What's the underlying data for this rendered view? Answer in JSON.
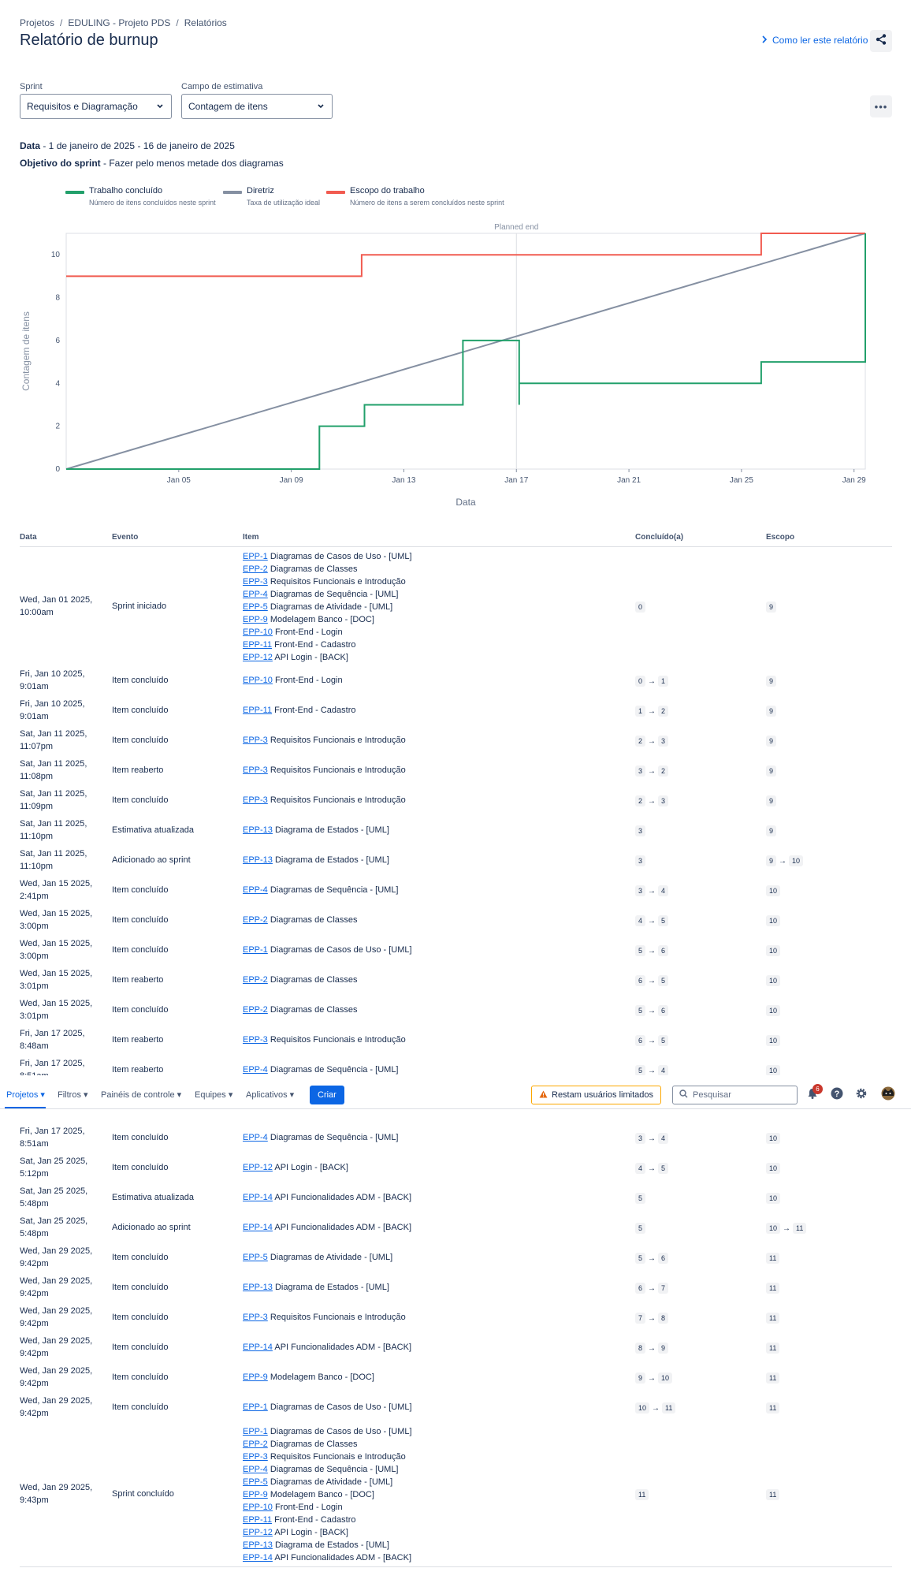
{
  "breadcrumb": {
    "projects": "Projetos",
    "project": "EDULING - Projeto PDS",
    "reports": "Relatórios"
  },
  "page_title": "Relatório de burnup",
  "how_to_read": "Como ler este relatório",
  "filters": {
    "sprint_label": "Sprint",
    "sprint_value": "Requisitos e Diagramação",
    "estimate_label": "Campo de estimativa",
    "estimate_value": "Contagem de itens"
  },
  "info": {
    "date_label": "Data",
    "date_value": " - 1 de janeiro de 2025 - 16 de janeiro de 2025",
    "goal_label": "Objetivo do sprint",
    "goal_value": " - Fazer pelo menos metade dos diagramas"
  },
  "legend": [
    {
      "name": "Trabalho concluído",
      "desc": "Número de itens concluídos neste sprint",
      "color": "#22a06b"
    },
    {
      "name": "Diretriz",
      "desc": "Taxa de utilização ideal",
      "color": "#8590a2"
    },
    {
      "name": "Escopo do trabalho",
      "desc": "Número de itens a serem concluídos neste sprint",
      "color": "#f15b50"
    }
  ],
  "chart_data": {
    "type": "line",
    "annotation": "Planned end",
    "annotation_x": 17.0,
    "xlabel": "Data",
    "ylabel": "Contagem de itens",
    "xlim": [
      1.0,
      29.4
    ],
    "ylim": [
      0,
      11
    ],
    "x_ticks": [
      {
        "x": 5,
        "label": "Jan 05"
      },
      {
        "x": 9,
        "label": "Jan 09"
      },
      {
        "x": 13,
        "label": "Jan 13"
      },
      {
        "x": 17,
        "label": "Jan 17"
      },
      {
        "x": 21,
        "label": "Jan 21"
      },
      {
        "x": 25,
        "label": "Jan 25"
      },
      {
        "x": 29,
        "label": "Jan 29"
      }
    ],
    "y_ticks": [
      0,
      2,
      4,
      6,
      8,
      10
    ],
    "series": [
      {
        "name": "Trabalho concluído",
        "color": "#22a06b",
        "points": [
          [
            1.0,
            0
          ],
          [
            10.0,
            0
          ],
          [
            10.0,
            2
          ],
          [
            11.6,
            2
          ],
          [
            11.6,
            3
          ],
          [
            15.1,
            3
          ],
          [
            15.1,
            6
          ],
          [
            17.1,
            6
          ],
          [
            17.1,
            4
          ],
          [
            17.1,
            3
          ],
          [
            17.1,
            4
          ],
          [
            25.7,
            4
          ],
          [
            25.7,
            5
          ],
          [
            29.4,
            5
          ],
          [
            29.4,
            11
          ]
        ]
      },
      {
        "name": "Diretriz",
        "color": "#8590a2",
        "points": [
          [
            1.0,
            0
          ],
          [
            29.4,
            11
          ]
        ]
      },
      {
        "name": "Escopo do trabalho",
        "color": "#f15b50",
        "points": [
          [
            1.0,
            9
          ],
          [
            11.5,
            9
          ],
          [
            11.5,
            10
          ],
          [
            25.7,
            10
          ],
          [
            25.7,
            11
          ],
          [
            29.4,
            11
          ]
        ]
      }
    ]
  },
  "table": {
    "headers": [
      "Data",
      "Evento",
      "Item",
      "Concluído(a)",
      "Escopo"
    ],
    "rows": [
      {
        "date": [
          "Wed, Jan 01 2025,",
          "10:00am"
        ],
        "event": "Sprint iniciado",
        "items": [
          [
            "EPP-1",
            "Diagramas de Casos de Uso - [UML]"
          ],
          [
            "EPP-2",
            "Diagramas de Classes"
          ],
          [
            "EPP-3",
            "Requisitos Funcionais e Introdução"
          ],
          [
            "EPP-4",
            "Diagramas de Sequência - [UML]"
          ],
          [
            "EPP-5",
            "Diagramas de Atividade - [UML]"
          ],
          [
            "EPP-9",
            "Modelagem Banco - [DOC]"
          ],
          [
            "EPP-10",
            "Front-End - Login"
          ],
          [
            "EPP-11",
            "Front-End - Cadastro"
          ],
          [
            "EPP-12",
            "API Login - [BACK]"
          ]
        ],
        "done": [
          "0"
        ],
        "scope": [
          "9"
        ]
      },
      {
        "date": [
          "Fri, Jan 10 2025,",
          "9:01am"
        ],
        "event": "Item concluído",
        "items": [
          [
            "EPP-10",
            "Front-End - Login"
          ]
        ],
        "done": [
          "0",
          "1"
        ],
        "scope": [
          "9"
        ]
      },
      {
        "date": [
          "Fri, Jan 10 2025,",
          "9:01am"
        ],
        "event": "Item concluído",
        "items": [
          [
            "EPP-11",
            "Front-End - Cadastro"
          ]
        ],
        "done": [
          "1",
          "2"
        ],
        "scope": [
          "9"
        ]
      },
      {
        "date": [
          "Sat, Jan 11 2025,",
          "11:07pm"
        ],
        "event": "Item concluído",
        "items": [
          [
            "EPP-3",
            "Requisitos Funcionais e Introdução"
          ]
        ],
        "done": [
          "2",
          "3"
        ],
        "scope": [
          "9"
        ]
      },
      {
        "date": [
          "Sat, Jan 11 2025,",
          "11:08pm"
        ],
        "event": "Item reaberto",
        "items": [
          [
            "EPP-3",
            "Requisitos Funcionais e Introdução"
          ]
        ],
        "done": [
          "3",
          "2"
        ],
        "scope": [
          "9"
        ]
      },
      {
        "date": [
          "Sat, Jan 11 2025,",
          "11:09pm"
        ],
        "event": "Item concluído",
        "items": [
          [
            "EPP-3",
            "Requisitos Funcionais e Introdução"
          ]
        ],
        "done": [
          "2",
          "3"
        ],
        "scope": [
          "9"
        ]
      },
      {
        "date": [
          "Sat, Jan 11 2025,",
          "11:10pm"
        ],
        "event": "Estimativa atualizada",
        "items": [
          [
            "EPP-13",
            "Diagrama de Estados - [UML]"
          ]
        ],
        "done": [
          "3"
        ],
        "scope": [
          "9"
        ]
      },
      {
        "date": [
          "Sat, Jan 11 2025,",
          "11:10pm"
        ],
        "event": "Adicionado ao sprint",
        "items": [
          [
            "EPP-13",
            "Diagrama de Estados - [UML]"
          ]
        ],
        "done": [
          "3"
        ],
        "scope": [
          "9",
          "10"
        ]
      },
      {
        "date": [
          "Wed, Jan 15 2025,",
          "2:41pm"
        ],
        "event": "Item concluído",
        "items": [
          [
            "EPP-4",
            "Diagramas de Sequência - [UML]"
          ]
        ],
        "done": [
          "3",
          "4"
        ],
        "scope": [
          "10"
        ]
      },
      {
        "date": [
          "Wed, Jan 15 2025,",
          "3:00pm"
        ],
        "event": "Item concluído",
        "items": [
          [
            "EPP-2",
            "Diagramas de Classes"
          ]
        ],
        "done": [
          "4",
          "5"
        ],
        "scope": [
          "10"
        ]
      },
      {
        "date": [
          "Wed, Jan 15 2025,",
          "3:00pm"
        ],
        "event": "Item concluído",
        "items": [
          [
            "EPP-1",
            "Diagramas de Casos de Uso - [UML]"
          ]
        ],
        "done": [
          "5",
          "6"
        ],
        "scope": [
          "10"
        ]
      },
      {
        "date": [
          "Wed, Jan 15 2025,",
          "3:01pm"
        ],
        "event": "Item reaberto",
        "items": [
          [
            "EPP-2",
            "Diagramas de Classes"
          ]
        ],
        "done": [
          "6",
          "5"
        ],
        "scope": [
          "10"
        ]
      },
      {
        "date": [
          "Wed, Jan 15 2025,",
          "3:01pm"
        ],
        "event": "Item concluído",
        "items": [
          [
            "EPP-2",
            "Diagramas de Classes"
          ]
        ],
        "done": [
          "5",
          "6"
        ],
        "scope": [
          "10"
        ]
      },
      {
        "date": [
          "Fri, Jan 17 2025,",
          "8:48am"
        ],
        "event": "Item reaberto",
        "items": [
          [
            "EPP-3",
            "Requisitos Funcionais e Introdução"
          ]
        ],
        "done": [
          "6",
          "5"
        ],
        "scope": [
          "10"
        ]
      },
      {
        "date": [
          "Fri, Jan 17 2025,",
          "8:51am"
        ],
        "event": "Item reaberto",
        "items": [
          [
            "EPP-4",
            "Diagramas de Sequência - [UML]"
          ]
        ],
        "done": [
          "5",
          "4"
        ],
        "scope": [
          "10"
        ]
      },
      {
        "date": [
          "Fri, Jan 17 2025,",
          "8:51am"
        ],
        "event": "Item concluído",
        "items": [
          [
            "EPP-4",
            "Diagramas de Sequência - [UML]"
          ]
        ],
        "done": [
          "3",
          "4"
        ],
        "scope": [
          "10"
        ]
      },
      {
        "date": [
          "Sat, Jan 25 2025,",
          "5:12pm"
        ],
        "event": "Item concluído",
        "items": [
          [
            "EPP-12",
            "API Login - [BACK]"
          ]
        ],
        "done": [
          "4",
          "5"
        ],
        "scope": [
          "10"
        ]
      },
      {
        "date": [
          "Sat, Jan 25 2025,",
          "5:48pm"
        ],
        "event": "Estimativa atualizada",
        "items": [
          [
            "EPP-14",
            "API Funcionalidades ADM - [BACK]"
          ]
        ],
        "done": [
          "5"
        ],
        "scope": [
          "10"
        ]
      },
      {
        "date": [
          "Sat, Jan 25 2025,",
          "5:48pm"
        ],
        "event": "Adicionado ao sprint",
        "items": [
          [
            "EPP-14",
            "API Funcionalidades ADM - [BACK]"
          ]
        ],
        "done": [
          "5"
        ],
        "scope": [
          "10",
          "11"
        ]
      },
      {
        "date": [
          "Wed, Jan 29 2025,",
          "9:42pm"
        ],
        "event": "Item concluído",
        "items": [
          [
            "EPP-5",
            "Diagramas de Atividade - [UML]"
          ]
        ],
        "done": [
          "5",
          "6"
        ],
        "scope": [
          "11"
        ]
      },
      {
        "date": [
          "Wed, Jan 29 2025,",
          "9:42pm"
        ],
        "event": "Item concluído",
        "items": [
          [
            "EPP-13",
            "Diagrama de Estados - [UML]"
          ]
        ],
        "done": [
          "6",
          "7"
        ],
        "scope": [
          "11"
        ]
      },
      {
        "date": [
          "Wed, Jan 29 2025,",
          "9:42pm"
        ],
        "event": "Item concluído",
        "items": [
          [
            "EPP-3",
            "Requisitos Funcionais e Introdução"
          ]
        ],
        "done": [
          "7",
          "8"
        ],
        "scope": [
          "11"
        ]
      },
      {
        "date": [
          "Wed, Jan 29 2025,",
          "9:42pm"
        ],
        "event": "Item concluído",
        "items": [
          [
            "EPP-14",
            "API Funcionalidades ADM - [BACK]"
          ]
        ],
        "done": [
          "8",
          "9"
        ],
        "scope": [
          "11"
        ]
      },
      {
        "date": [
          "Wed, Jan 29 2025,",
          "9:42pm"
        ],
        "event": "Item concluído",
        "items": [
          [
            "EPP-9",
            "Modelagem Banco - [DOC]"
          ]
        ],
        "done": [
          "9",
          "10"
        ],
        "scope": [
          "11"
        ]
      },
      {
        "date": [
          "Wed, Jan 29 2025,",
          "9:42pm"
        ],
        "event": "Item concluído",
        "items": [
          [
            "EPP-1",
            "Diagramas de Casos de Uso - [UML]"
          ]
        ],
        "done": [
          "10",
          "11"
        ],
        "scope": [
          "11"
        ]
      },
      {
        "date": [
          "Wed, Jan 29 2025,",
          "9:43pm"
        ],
        "event": "Sprint concluído",
        "items": [
          [
            "EPP-1",
            "Diagramas de Casos de Uso - [UML]"
          ],
          [
            "EPP-2",
            "Diagramas de Classes"
          ],
          [
            "EPP-3",
            "Requisitos Funcionais e Introdução"
          ],
          [
            "EPP-4",
            "Diagramas de Sequência - [UML]"
          ],
          [
            "EPP-5",
            "Diagramas de Atividade - [UML]"
          ],
          [
            "EPP-9",
            "Modelagem Banco - [DOC]"
          ],
          [
            "EPP-10",
            "Front-End - Login"
          ],
          [
            "EPP-11",
            "Front-End - Cadastro"
          ],
          [
            "EPP-12",
            "API Login - [BACK]"
          ],
          [
            "EPP-13",
            "Diagrama de Estados - [UML]"
          ],
          [
            "EPP-14",
            "API Funcionalidades ADM - [BACK]"
          ]
        ],
        "done": [
          "11"
        ],
        "scope": [
          "11"
        ]
      }
    ]
  },
  "navbar": {
    "projects": "Projetos",
    "filters": "Filtros",
    "dashboards": "Painéis de controle",
    "teams": "Equipes",
    "apps": "Aplicativos",
    "create": "Criar",
    "limited_users": "Restam usuários limitados",
    "search_placeholder": "Pesquisar",
    "notifications_count": "6"
  }
}
